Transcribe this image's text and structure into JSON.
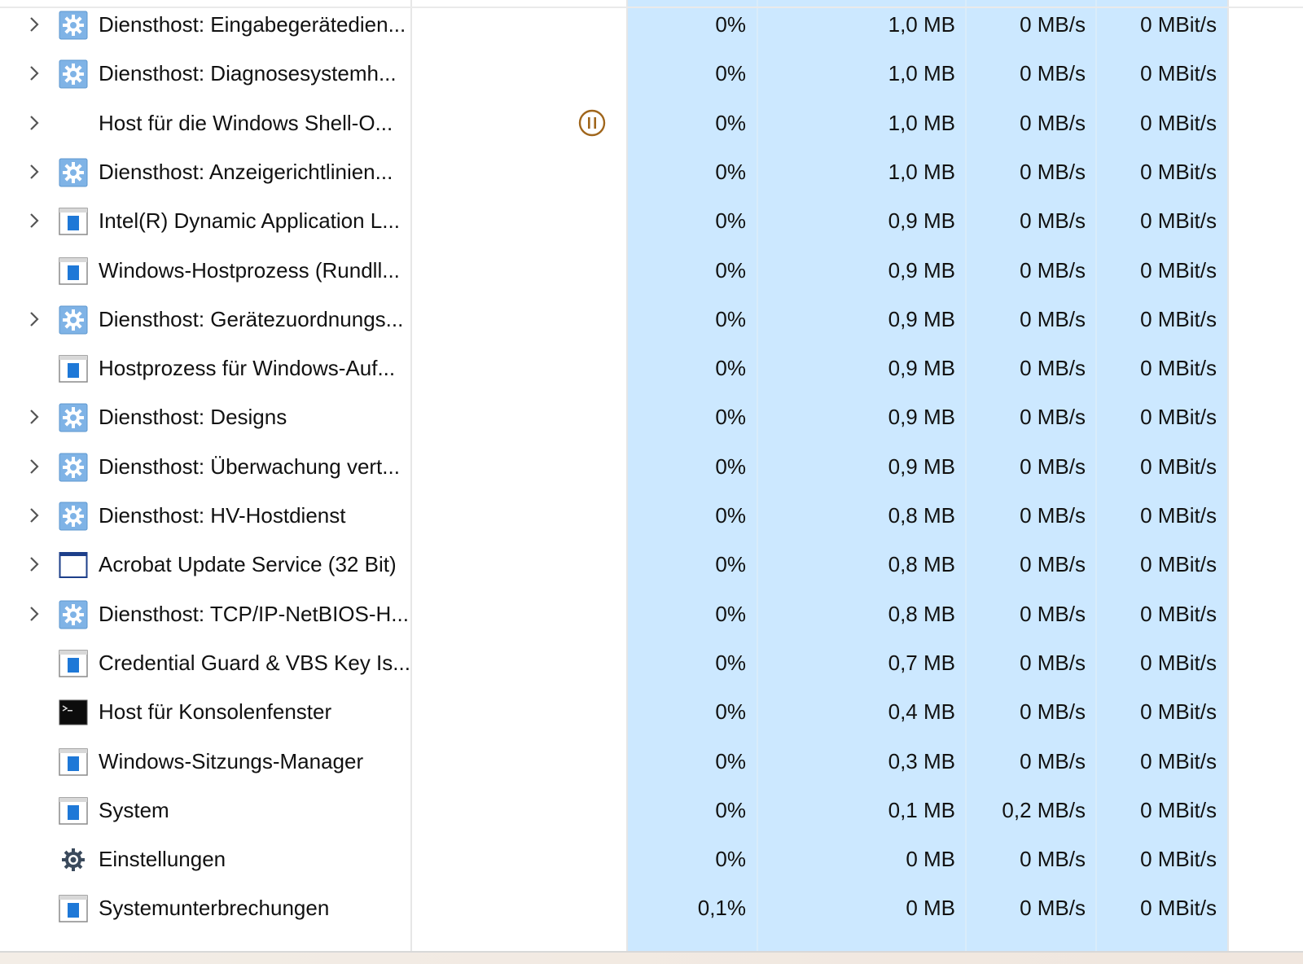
{
  "processes": [
    {
      "name": "Diensthost: Eingabegerätedien...",
      "icon": "gear-icon",
      "expandable": true,
      "status": "",
      "cpu": "0%",
      "memory": "1,0 MB",
      "disk": "0 MB/s",
      "network": "0 MBit/s"
    },
    {
      "name": "Diensthost: Diagnosesystemh...",
      "icon": "gear-icon",
      "expandable": true,
      "status": "",
      "cpu": "0%",
      "memory": "1,0 MB",
      "disk": "0 MB/s",
      "network": "0 MBit/s"
    },
    {
      "name": "Host für die Windows Shell-O...",
      "icon": "",
      "expandable": true,
      "status": "suspended",
      "cpu": "0%",
      "memory": "1,0 MB",
      "disk": "0 MB/s",
      "network": "0 MBit/s"
    },
    {
      "name": "Diensthost: Anzeigerichtlinien...",
      "icon": "gear-icon",
      "expandable": true,
      "status": "",
      "cpu": "0%",
      "memory": "1,0 MB",
      "disk": "0 MB/s",
      "network": "0 MBit/s"
    },
    {
      "name": "Intel(R) Dynamic Application L...",
      "icon": "app-window-icon",
      "expandable": true,
      "status": "",
      "cpu": "0%",
      "memory": "0,9 MB",
      "disk": "0 MB/s",
      "network": "0 MBit/s"
    },
    {
      "name": "Windows-Hostprozess (Rundll...",
      "icon": "app-window-icon",
      "expandable": false,
      "status": "",
      "cpu": "0%",
      "memory": "0,9 MB",
      "disk": "0 MB/s",
      "network": "0 MBit/s"
    },
    {
      "name": "Diensthost: Gerätezuordnungs...",
      "icon": "gear-icon",
      "expandable": true,
      "status": "",
      "cpu": "0%",
      "memory": "0,9 MB",
      "disk": "0 MB/s",
      "network": "0 MBit/s"
    },
    {
      "name": "Hostprozess für Windows-Auf...",
      "icon": "app-window-icon",
      "expandable": false,
      "status": "",
      "cpu": "0%",
      "memory": "0,9 MB",
      "disk": "0 MB/s",
      "network": "0 MBit/s"
    },
    {
      "name": "Diensthost: Designs",
      "icon": "gear-icon",
      "expandable": true,
      "status": "",
      "cpu": "0%",
      "memory": "0,9 MB",
      "disk": "0 MB/s",
      "network": "0 MBit/s"
    },
    {
      "name": "Diensthost: Überwachung vert...",
      "icon": "gear-icon",
      "expandable": true,
      "status": "",
      "cpu": "0%",
      "memory": "0,9 MB",
      "disk": "0 MB/s",
      "network": "0 MBit/s"
    },
    {
      "name": "Diensthost: HV-Hostdienst",
      "icon": "gear-icon",
      "expandable": true,
      "status": "",
      "cpu": "0%",
      "memory": "0,8 MB",
      "disk": "0 MB/s",
      "network": "0 MBit/s"
    },
    {
      "name": "Acrobat Update Service (32 Bit)",
      "icon": "empty-window-icon",
      "expandable": true,
      "status": "",
      "cpu": "0%",
      "memory": "0,8 MB",
      "disk": "0 MB/s",
      "network": "0 MBit/s"
    },
    {
      "name": "Diensthost: TCP/IP-NetBIOS-H...",
      "icon": "gear-icon",
      "expandable": true,
      "status": "",
      "cpu": "0%",
      "memory": "0,8 MB",
      "disk": "0 MB/s",
      "network": "0 MBit/s"
    },
    {
      "name": "Credential Guard & VBS Key Is...",
      "icon": "app-window-icon",
      "expandable": false,
      "status": "",
      "cpu": "0%",
      "memory": "0,7 MB",
      "disk": "0 MB/s",
      "network": "0 MBit/s"
    },
    {
      "name": "Host für Konsolenfenster",
      "icon": "console-icon",
      "expandable": false,
      "status": "",
      "cpu": "0%",
      "memory": "0,4 MB",
      "disk": "0 MB/s",
      "network": "0 MBit/s"
    },
    {
      "name": "Windows-Sitzungs-Manager",
      "icon": "app-window-icon",
      "expandable": false,
      "status": "",
      "cpu": "0%",
      "memory": "0,3 MB",
      "disk": "0 MB/s",
      "network": "0 MBit/s"
    },
    {
      "name": "System",
      "icon": "app-window-icon",
      "expandable": false,
      "status": "",
      "cpu": "0%",
      "memory": "0,1 MB",
      "disk": "0,2 MB/s",
      "network": "0 MBit/s"
    },
    {
      "name": "Einstellungen",
      "icon": "settings-cog-icon",
      "expandable": false,
      "status": "",
      "cpu": "0%",
      "memory": "0 MB",
      "disk": "0 MB/s",
      "network": "0 MBit/s"
    },
    {
      "name": "Systemunterbrechungen",
      "icon": "app-window-icon",
      "expandable": false,
      "status": "",
      "cpu": "0,1%",
      "memory": "0 MB",
      "disk": "0 MB/s",
      "network": "0 MBit/s"
    }
  ],
  "colors": {
    "highlight_column": "#cce8ff",
    "suspended_status": "#a0661c",
    "app_icon_blue": "#1e78d7"
  }
}
